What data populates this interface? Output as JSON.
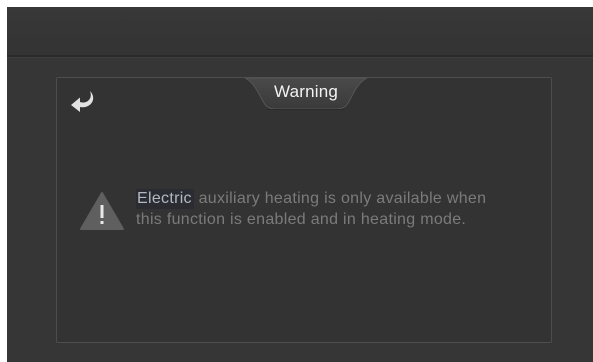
{
  "dialog": {
    "title": "Warning",
    "message_highlight": "Electric",
    "message_rest": " auxiliary heating is only available when",
    "message_line2": "this function is enabled and in heating mode.",
    "back_icon": "back-arrow-icon",
    "warning_icon": "warning-triangle-icon"
  },
  "colors": {
    "background": "#363636",
    "panel_border": "#4d4d4d",
    "title_text": "#f2f2f2",
    "message_text": "#7b7b7b"
  }
}
